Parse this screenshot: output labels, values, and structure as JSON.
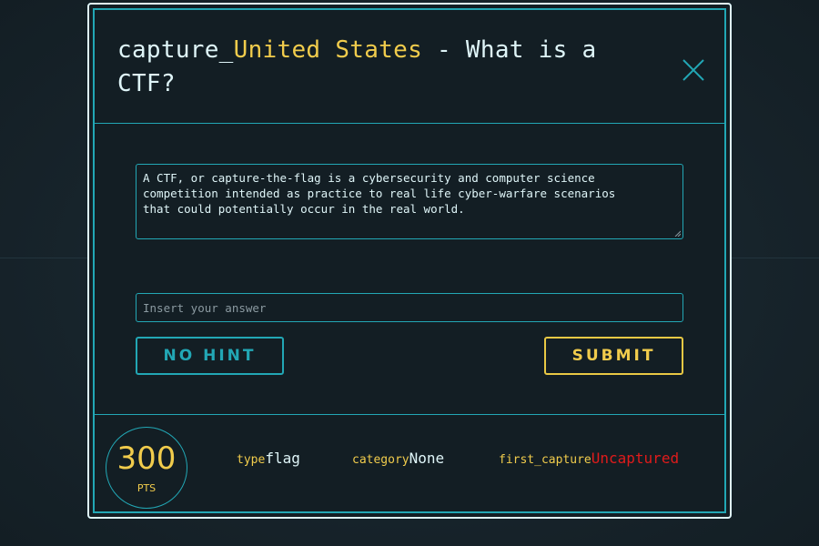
{
  "modal": {
    "title_prefix": "capture_",
    "title_country": "United States",
    "title_suffix": " - What is a CTF?",
    "close_icon": "close-icon"
  },
  "challenge": {
    "description": "A CTF, or capture-the-flag is a cybersecurity and computer science\ncompetition intended as practice to real life cyber-warfare scenarios\nthat could potentially occur in the real world.",
    "answer_placeholder": "Insert your answer",
    "answer_value": "",
    "hint_label": "NO HINT",
    "submit_label": "SUBMIT"
  },
  "footer": {
    "points": "300",
    "points_unit": "PTS",
    "type_key": "type",
    "type_value": "flag",
    "category_key": "category",
    "category_value": "None",
    "first_capture_key": "first_capture",
    "first_capture_value": "Uncaptured"
  },
  "colors": {
    "background": "#17252d",
    "panel": "#131e24",
    "accent_cyan": "#22a7b5",
    "accent_yellow": "#f1cc4c",
    "text_light": "#dff5f8",
    "uncaptured_red": "#e01b1b"
  }
}
